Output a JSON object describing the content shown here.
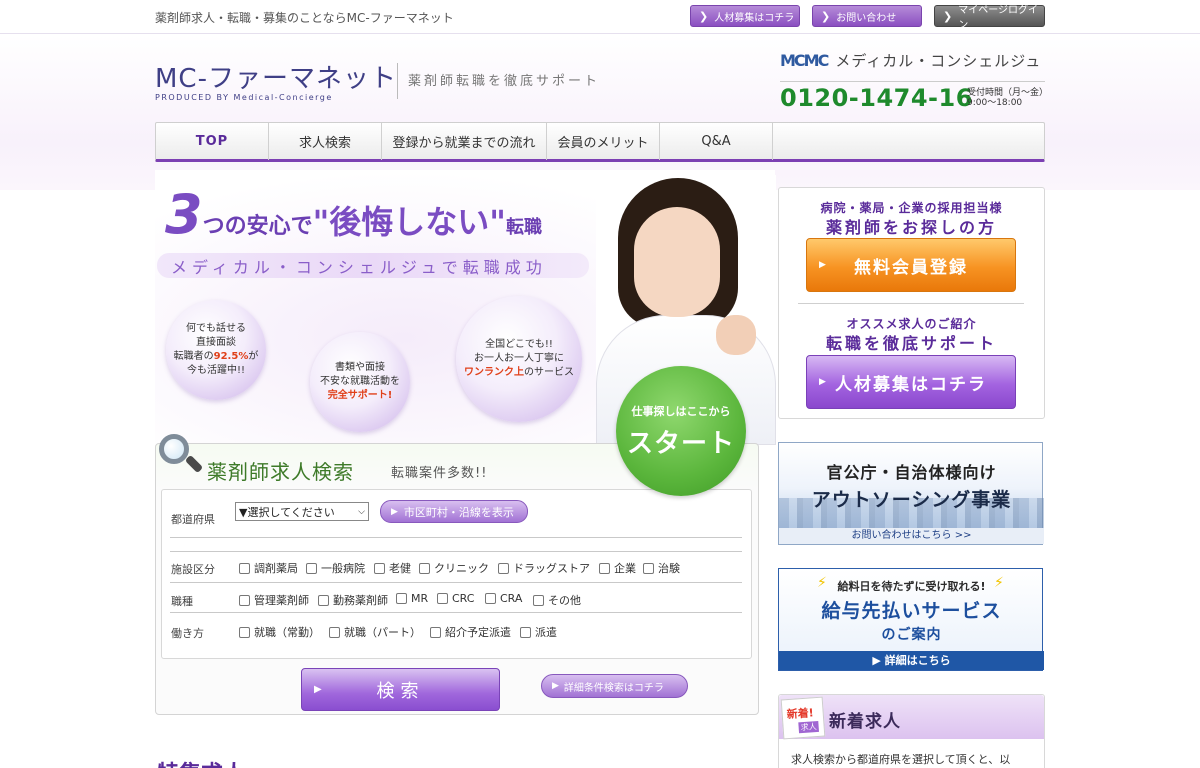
{
  "top": {
    "tagline": "薬剤師求人・転職・募集のことならMC-ファーマネット",
    "buttons": [
      {
        "label": "人材募集はコチラ"
      },
      {
        "label": "お問い合わせ"
      },
      {
        "label": "マイページログイン"
      }
    ]
  },
  "logo": {
    "main": "MC-ファーマネット",
    "sub": "PRODUCED BY Medical-Concierge",
    "tagline": "薬剤師転職を徹底サポート"
  },
  "brand": {
    "mark": "MCMC",
    "name": "メディカル・コンシェルジュ",
    "phone": "0120-1474-16",
    "hours_line1": "受付時間（月〜金）",
    "hours_line2": "9:00〜18:00"
  },
  "nav": [
    {
      "label": "TOP"
    },
    {
      "label": "求人検索"
    },
    {
      "label": "登録から就業までの流れ"
    },
    {
      "label": "会員のメリット"
    },
    {
      "label": "Q&A"
    }
  ],
  "hero": {
    "big": "3",
    "t1": "つの安心で",
    "t2": "\"後悔しない\"",
    "t3": "転職",
    "sub": "メディカル・コンシェルジュで転職成功",
    "bubbles": [
      {
        "l1": "何でも話せる",
        "l2": "直接面談",
        "l3a": "転職者の",
        "l3b": "92.5%",
        "l3c": "が",
        "l4": "今も活躍中!!"
      },
      {
        "l1": "書類や面接",
        "l2": "不安な就職活動を",
        "l3": "完全サポート!"
      },
      {
        "l1": "全国どこでも!!",
        "l2": "お一人お一人丁寧に",
        "l3a": "ワンランク上",
        "l3b": "のサービス"
      }
    ],
    "start_small": "仕事探しはここから",
    "start_big": "スタート"
  },
  "search": {
    "title": "薬剤師求人検索",
    "note": "転職案件多数!!",
    "pref_label": "都道府県",
    "pref_value": "▼選択してください",
    "city_btn": "市区町村・沿線を表示",
    "facility_label": "施設区分",
    "facility": [
      "調剤薬局",
      "一般病院",
      "老健",
      "クリニック",
      "ドラッグストア",
      "企業",
      "治験"
    ],
    "job_label": "職種",
    "jobs": [
      "管理薬剤師",
      "勤務薬剤師",
      "MR",
      "CRC",
      "CRA",
      "その他"
    ],
    "work_label": "働き方",
    "work": [
      "就職（常勤）",
      "就職（パート）",
      "紹介予定派遣",
      "派遣"
    ],
    "search_btn": "検索",
    "detail_btn": "詳細条件検索はコチラ"
  },
  "feature_title": "特集求人",
  "right": {
    "r1_t1": "病院・薬局・企業の採用担当様",
    "r1_t2": "薬剤師をお探しの方",
    "r1_btn": "無料会員登録",
    "r2_t1": "オススメ求人のご紹介",
    "r2_t2": "転職を徹底サポート",
    "r2_btn": "人材募集はコチラ",
    "gov_1": "官公庁・自治体様向け",
    "gov_2": "アウトソーシング事業",
    "gov_3": "お問い合わせはこちら >>",
    "pay_1": "給料日を待たずに受け取れる!",
    "pay_2": "給与先払いサービス",
    "pay_3": "のご案内",
    "pay_4": "▶ 詳細はこちら",
    "new_tag_a": "新着!",
    "new_tag_b": "求人",
    "new_title": "新着求人",
    "new_body": "求人検索から都道府県を選択して頂くと、以"
  }
}
